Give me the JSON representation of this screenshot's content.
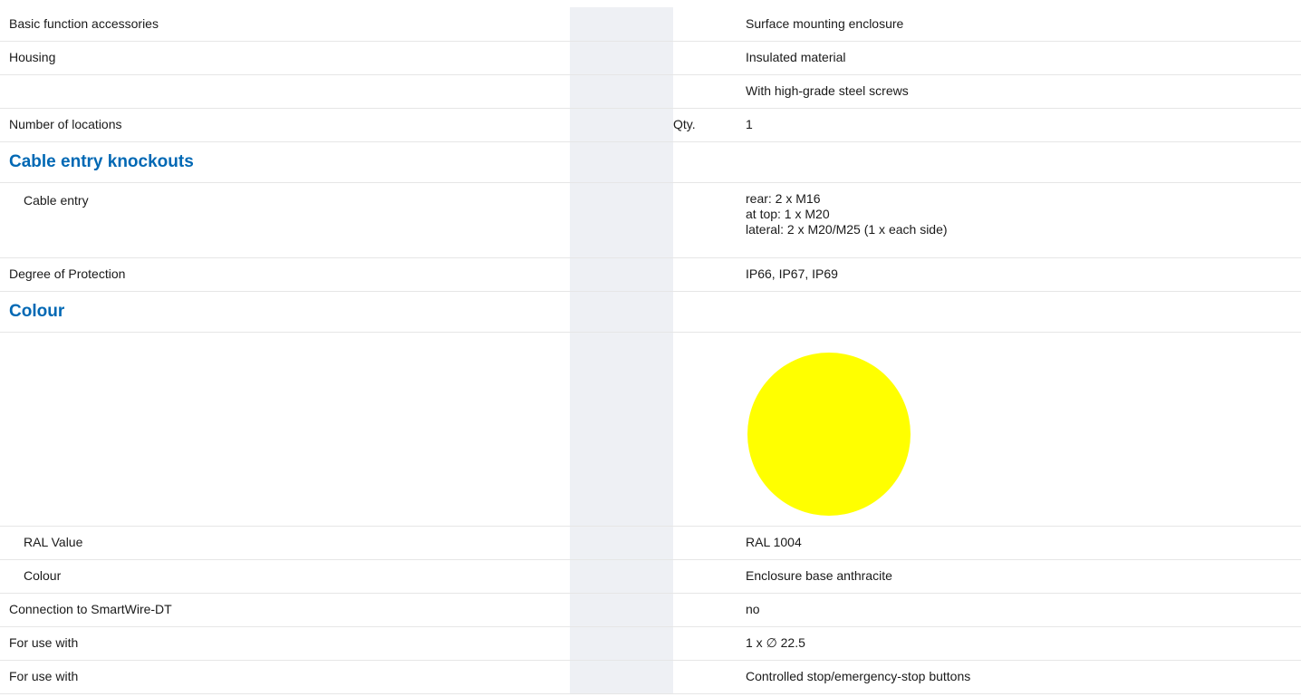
{
  "colors": {
    "section_heading": "#0068b4",
    "shade_column": "#eef0f4",
    "row_divider": "#e6e6e6",
    "colour_swatch": "#ffff00"
  },
  "rows": {
    "basic_function": {
      "label": "Basic function accessories",
      "unit": "",
      "value": "Surface mounting enclosure"
    },
    "housing": {
      "label": "Housing",
      "unit": "",
      "value": "Insulated material"
    },
    "housing_extra": {
      "label": "",
      "unit": "",
      "value": "With high-grade steel screws"
    },
    "locations": {
      "label": "Number of locations",
      "unit": "Qty.",
      "value": "1"
    },
    "cable_section": {
      "label": "Cable entry knockouts"
    },
    "cable_entry": {
      "label": "Cable entry",
      "unit": "",
      "values": [
        "rear: 2 x M16",
        "at top: 1 x M20",
        "lateral: 2 x M20/M25 (1 x each side)"
      ]
    },
    "protection": {
      "label": "Degree of Protection",
      "unit": "",
      "value": "IP66, IP67, IP69"
    },
    "colour_section": {
      "label": "Colour"
    },
    "ral": {
      "label": "RAL Value",
      "unit": "",
      "value": "RAL 1004"
    },
    "colour": {
      "label": "Colour",
      "unit": "",
      "value": "Enclosure base anthracite"
    },
    "smartwire": {
      "label": "Connection to SmartWire-DT",
      "unit": "",
      "value": "no"
    },
    "use_with_1": {
      "label": "For use with",
      "unit": "",
      "value": "1 x ∅ 22.5"
    },
    "use_with_2": {
      "label": "For use with",
      "unit": "",
      "value": "Controlled stop/emergency-stop buttons"
    }
  }
}
